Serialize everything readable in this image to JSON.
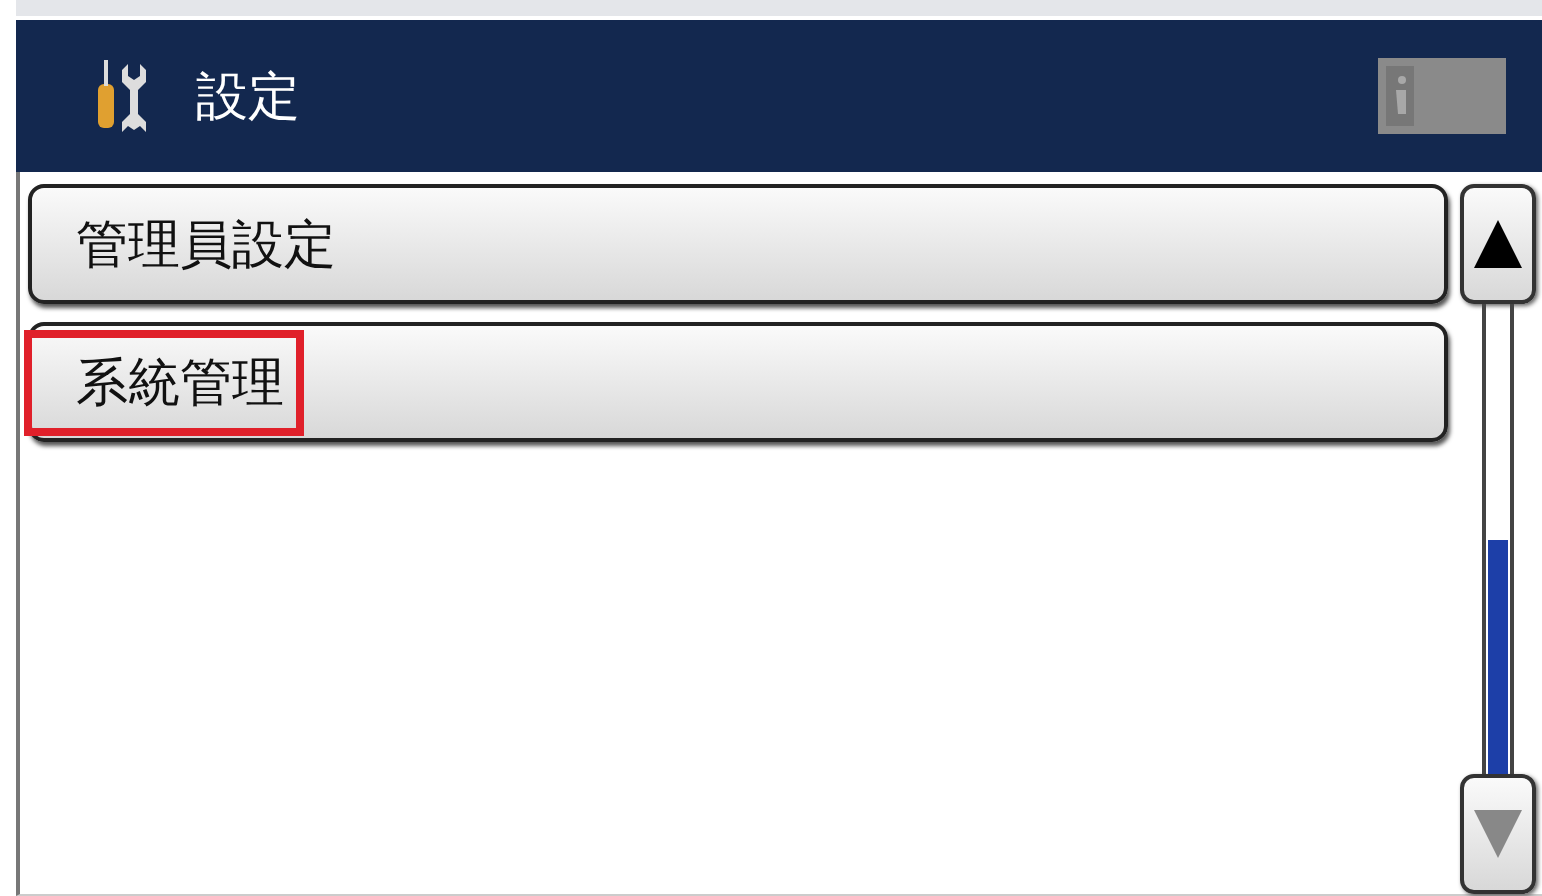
{
  "header": {
    "title": "設定"
  },
  "menu": [
    {
      "label": "管理員設定",
      "highlighted": false
    },
    {
      "label": "系統管理",
      "highlighted": true
    }
  ],
  "scroll_buttons": [
    {
      "kind": "up",
      "disabled": false
    },
    {
      "kind": "down",
      "disabled": true
    }
  ]
}
